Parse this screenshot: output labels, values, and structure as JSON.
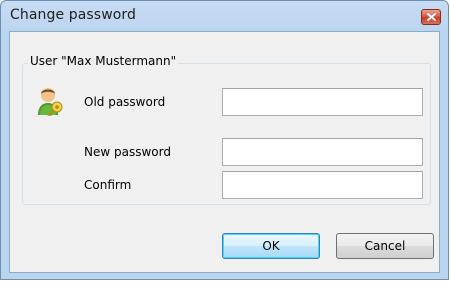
{
  "window": {
    "title": "Change password"
  },
  "group": {
    "legend": "User \"Max Mustermann\""
  },
  "fields": {
    "old_label": "Old password",
    "old_value": "",
    "new_label": "New password",
    "new_value": "",
    "confirm_label": "Confirm",
    "confirm_value": ""
  },
  "buttons": {
    "ok_label": "OK",
    "cancel_label": "Cancel"
  },
  "icons": {
    "close": "close-icon",
    "user": "user-key-icon"
  },
  "colors": {
    "titlebar": "#c7dcf3",
    "client": "#f0f0f0",
    "close": "#c43a22",
    "default_button_border": "#3c7fb1"
  }
}
